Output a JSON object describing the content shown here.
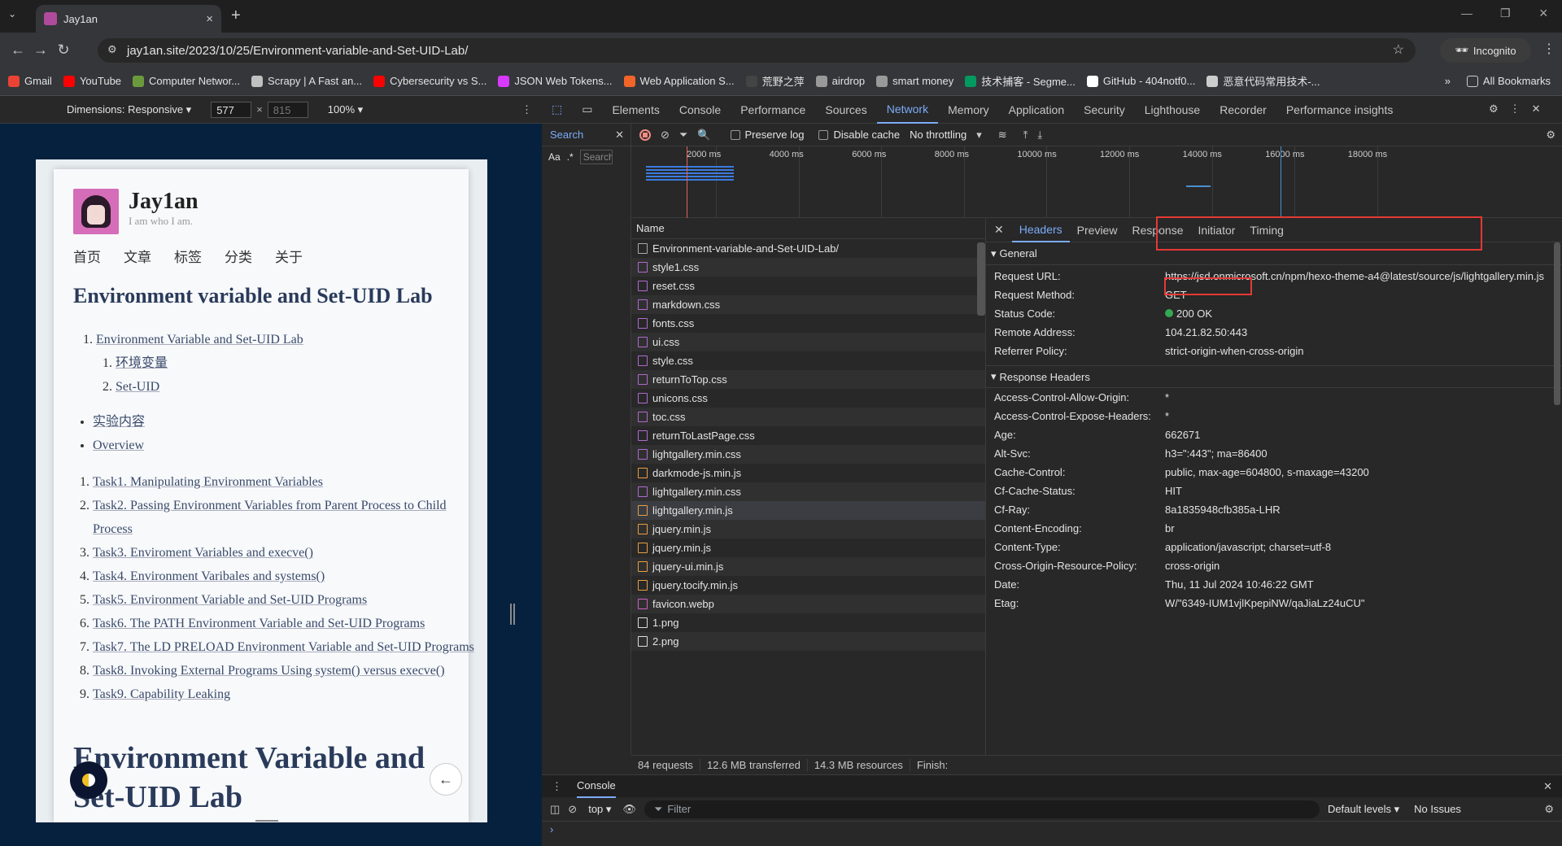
{
  "tab": {
    "title": "Jay1an",
    "close": "×",
    "new": "+"
  },
  "address": {
    "url": "jay1an.site/2023/10/25/Environment-variable-and-Set-UID-Lab/",
    "incognito": "Incognito"
  },
  "bookmarks": [
    {
      "label": "Gmail",
      "color": "#ea4335"
    },
    {
      "label": "YouTube",
      "color": "#ff0000"
    },
    {
      "label": "Computer Networ...",
      "color": "#6b9a3c"
    },
    {
      "label": "Scrapy | A Fast an...",
      "color": "#c0c0c0"
    },
    {
      "label": "Cybersecurity vs S...",
      "color": "#ff0000"
    },
    {
      "label": "JSON Web Tokens...",
      "color": "#d63aff"
    },
    {
      "label": "Web Application S...",
      "color": "#f16529"
    },
    {
      "label": "荒野之萍",
      "color": "#444"
    },
    {
      "label": "airdrop",
      "color": "#999"
    },
    {
      "label": "smart money",
      "color": "#999"
    },
    {
      "label": "技术捕客 - Segme...",
      "color": "#009a61"
    },
    {
      "label": "GitHub - 404notf0...",
      "color": "#ffffff"
    },
    {
      "label": "恶意代码常用技术-...",
      "color": "#ccc"
    }
  ],
  "all_bookmarks": "All Bookmarks",
  "device": {
    "dimensions": "Dimensions: Responsive ▾",
    "width": "577",
    "height": "815",
    "zoom": "100% ▾"
  },
  "site": {
    "name": "Jay1an",
    "tagline": "I am who I am.",
    "nav": [
      "首页",
      "文章",
      "标签",
      "分类",
      "关于"
    ],
    "title": "Environment variable and Set-UID Lab",
    "toc1": {
      "item": "Environment Variable and Set-UID Lab",
      "sub": [
        "环境变量",
        "Set-UID"
      ]
    },
    "bullets": [
      "实验内容",
      "Overview"
    ],
    "tasks": [
      "Task1. Manipulating Environment Variables",
      "Task2. Passing Environment Variables from Parent Process to Child Process",
      "Task3. Enviroment Variables and execve()",
      "Task4. Environment Varibales and systems()",
      "Task5. Environment Variable and Set-UID Programs",
      "Task6. The PATH Environment Variable and Set-UID Programs",
      "Task7. The LD PRELOAD Environment Variable and Set-UID Programs",
      "Task8. Invoking External Programs Using system() versus execve()",
      "Task9. Capability Leaking"
    ],
    "heading2": "Environment Variable and Set-UID Lab"
  },
  "devtools": {
    "tabs": [
      "Elements",
      "Console",
      "Performance",
      "Sources",
      "Network",
      "Memory",
      "Application",
      "Security",
      "Lighthouse",
      "Recorder",
      "Performance insights"
    ],
    "active_tab": "Network",
    "search_label": "Search",
    "search_placeholder": "Search",
    "aa": "Aa",
    "preserve_log": "Preserve log",
    "disable_cache": "Disable cache",
    "throttling": "No throttling",
    "ticks": [
      "2000 ms",
      "4000 ms",
      "6000 ms",
      "8000 ms",
      "10000 ms",
      "12000 ms",
      "14000 ms",
      "16000 ms",
      "18000 ms"
    ],
    "name_header": "Name",
    "requests": [
      {
        "name": "Environment-variable-and-Set-UID-Lab/",
        "type": "doc"
      },
      {
        "name": "style1.css",
        "type": "css"
      },
      {
        "name": "reset.css",
        "type": "css"
      },
      {
        "name": "markdown.css",
        "type": "css"
      },
      {
        "name": "fonts.css",
        "type": "css"
      },
      {
        "name": "ui.css",
        "type": "css"
      },
      {
        "name": "style.css",
        "type": "css"
      },
      {
        "name": "returnToTop.css",
        "type": "css"
      },
      {
        "name": "unicons.css",
        "type": "css"
      },
      {
        "name": "toc.css",
        "type": "css"
      },
      {
        "name": "returnToLastPage.css",
        "type": "css"
      },
      {
        "name": "lightgallery.min.css",
        "type": "css"
      },
      {
        "name": "darkmode-js.min.js",
        "type": "js"
      },
      {
        "name": "lightgallery.min.css",
        "type": "css"
      },
      {
        "name": "lightgallery.min.js",
        "type": "js"
      },
      {
        "name": "jquery.min.js",
        "type": "js"
      },
      {
        "name": "jquery.min.js",
        "type": "js"
      },
      {
        "name": "jquery-ui.min.js",
        "type": "js"
      },
      {
        "name": "jquery.tocify.min.js",
        "type": "js"
      },
      {
        "name": "favicon.webp",
        "type": "img"
      },
      {
        "name": "1.png",
        "type": "png"
      },
      {
        "name": "2.png",
        "type": "png"
      }
    ],
    "status": {
      "requests": "84 requests",
      "transferred": "12.6 MB transferred",
      "resources": "14.3 MB resources",
      "finish": "Finish:"
    },
    "detail_tabs": [
      "Headers",
      "Preview",
      "Response",
      "Initiator",
      "Timing"
    ],
    "general_title": "General",
    "general": [
      {
        "k": "Request URL:",
        "v": "https://jsd.onmicrosoft.cn/npm/hexo-theme-a4@latest/source/js/lightgallery.min.js"
      },
      {
        "k": "Request Method:",
        "v": "GET"
      },
      {
        "k": "Status Code:",
        "v": "200 OK"
      },
      {
        "k": "Remote Address:",
        "v": "104.21.82.50:443"
      },
      {
        "k": "Referrer Policy:",
        "v": "strict-origin-when-cross-origin"
      }
    ],
    "resp_title": "Response Headers",
    "response": [
      {
        "k": "Access-Control-Allow-Origin:",
        "v": "*"
      },
      {
        "k": "Access-Control-Expose-Headers:",
        "v": "*"
      },
      {
        "k": "Age:",
        "v": "662671"
      },
      {
        "k": "Alt-Svc:",
        "v": "h3=\":443\"; ma=86400"
      },
      {
        "k": "Cache-Control:",
        "v": "public, max-age=604800, s-maxage=43200"
      },
      {
        "k": "Cf-Cache-Status:",
        "v": "HIT"
      },
      {
        "k": "Cf-Ray:",
        "v": "8a1835948cfb385a-LHR"
      },
      {
        "k": "Content-Encoding:",
        "v": "br"
      },
      {
        "k": "Content-Type:",
        "v": "application/javascript; charset=utf-8"
      },
      {
        "k": "Cross-Origin-Resource-Policy:",
        "v": "cross-origin"
      },
      {
        "k": "Date:",
        "v": "Thu, 11 Jul 2024 10:46:22 GMT"
      },
      {
        "k": "Etag:",
        "v": "W/\"6349-IUM1vjlKpepiNW/qaJiaLz24uCU\""
      }
    ],
    "console": {
      "label": "Console",
      "context": "top ▾",
      "filter": "Filter",
      "levels": "Default levels ▾",
      "issues": "No Issues",
      "prompt": "›"
    }
  }
}
